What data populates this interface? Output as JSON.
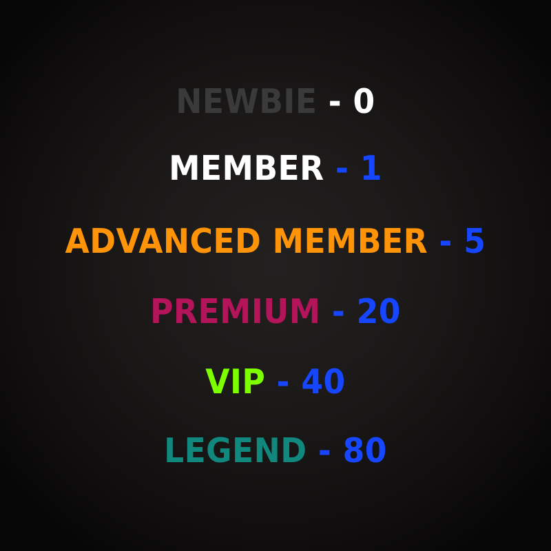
{
  "ranks": [
    {
      "name": "NEWBIE",
      "separator": " - ",
      "posts": "0",
      "name_color": "#3a3a3a",
      "posts_color": "#ffffff"
    },
    {
      "name": "MEMBER",
      "separator": " - ",
      "posts": "1",
      "name_color": "#ffffff",
      "posts_color": "#1646ff"
    },
    {
      "name": "ADVANCED MEMBER",
      "separator": " - ",
      "posts": "5",
      "name_color": "#ff9408",
      "posts_color": "#1646ff"
    },
    {
      "name": "PREMIUM",
      "separator": " - ",
      "posts": "20",
      "name_color": "#b3145a",
      "posts_color": "#1646ff"
    },
    {
      "name": "VIP",
      "separator": " - ",
      "posts": "40",
      "name_color": "#7dff00",
      "posts_color": "#1646ff"
    },
    {
      "name": "LEGEND",
      "separator": " - ",
      "posts": "80",
      "name_color": "#10887e",
      "posts_color": "#1646ff"
    }
  ]
}
